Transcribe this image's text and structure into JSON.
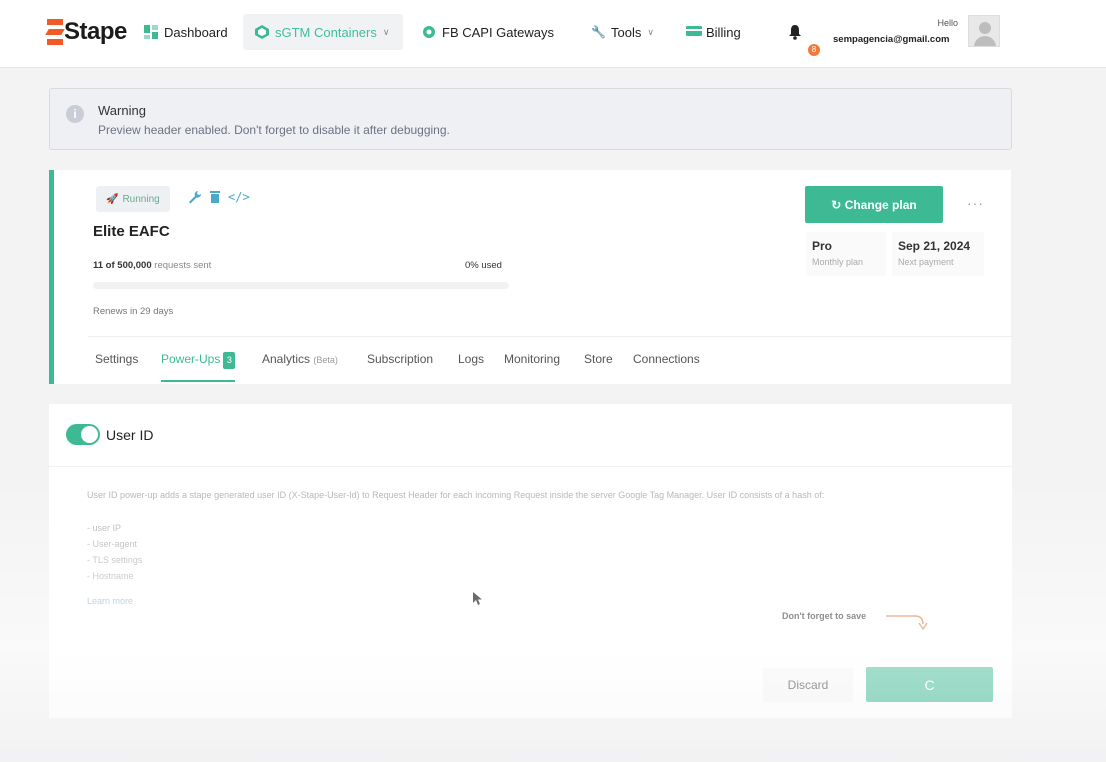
{
  "app": {
    "logo_text": "Stape"
  },
  "nav": {
    "dashboard": "Dashboard",
    "sgtm": "sGTM Containers",
    "fb_capi": "FB CAPI Gateways",
    "tools": "Tools",
    "billing": "Billing",
    "notifications_count": "8",
    "hello": "Hello",
    "email": "sempagencia@gmail.com"
  },
  "warning": {
    "title": "Warning",
    "text": "Preview header enabled. Don't forget to disable it after debugging."
  },
  "container": {
    "status": "Running",
    "name": "Elite EAFC",
    "requests_count": "11 of 500,000",
    "requests_suffix": "requests sent",
    "used": "0% used",
    "usage_fraction": 0.0,
    "renews": "Renews in 29 days",
    "change_plan": "Change plan",
    "plan": "Pro",
    "plan_sub": "Monthly plan",
    "next_payment": "Sep 21, 2024",
    "next_payment_sub": "Next payment"
  },
  "tabs": {
    "settings": "Settings",
    "powerups": "Power-Ups",
    "powerups_count": "3",
    "analytics": "Analytics",
    "analytics_beta": "(Beta)",
    "subscription": "Subscription",
    "logs": "Logs",
    "monitoring": "Monitoring",
    "store": "Store",
    "connections": "Connections"
  },
  "powerup": {
    "title": "User ID",
    "enabled": true,
    "description": "User ID power-up adds a stape generated user ID (X-Stape-User-Id) to Request Header for each incoming Request inside the server Google Tag Manager. User ID consists of a hash of:",
    "bullets": [
      "- user IP",
      "- User-agent",
      "- TLS settings",
      "- Hostname"
    ],
    "learn_more": "Learn more",
    "save_note": "Don't forget to save",
    "discard": "Discard",
    "save_glyph": "C"
  }
}
